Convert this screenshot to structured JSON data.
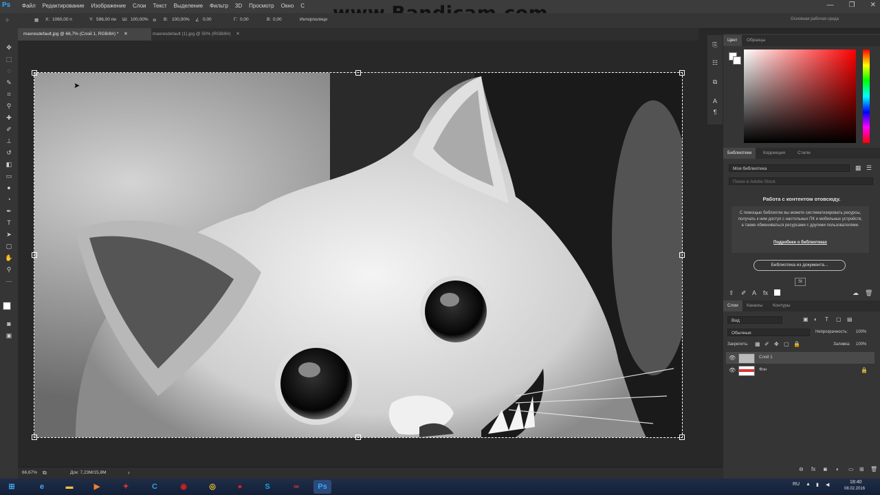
{
  "app": {
    "logo": "Ps",
    "watermark": "www.Bandicam.com"
  },
  "menu": [
    "Файл",
    "Редактирование",
    "Изображение",
    "Слои",
    "Текст",
    "Выделение",
    "Фильтр",
    "3D",
    "Просмотр",
    "Окно",
    "С"
  ],
  "window_controls": {
    "minimize": "—",
    "maximize": "❐",
    "close": "✕"
  },
  "options": {
    "x_label": "X:",
    "x_value": "1060,00 п",
    "y_label": "Y:",
    "y_value": "596,00 пи",
    "w_label": "Ш:",
    "w_value": "100,00%",
    "h_label": "В:",
    "h_value": "100,00%",
    "angle_value": "0,00",
    "hskew_label": "Г:",
    "hskew_value": "0,00",
    "vskew_label": "В:",
    "vskew_value": "0,00",
    "interpolation_label": "Интерполяци",
    "workspace": "Основная рабочая среда"
  },
  "tabs": [
    {
      "label": "maxresdefault.jpg @ 66,7% (Слой 1, RGB/8#) *",
      "close": "✕"
    },
    {
      "label": "maxresdefault (1).jpg @ 50% (RGB/8#)",
      "close": "✕"
    }
  ],
  "status": {
    "zoom": "66,67%",
    "doc": "Док: 7,23M/15,8M",
    "arrow": "›"
  },
  "color_panel": {
    "tabs": [
      "Цвет",
      "Образцы"
    ]
  },
  "libraries_panel": {
    "tabs": [
      "Библиотеки",
      "Коррекция",
      "Стили"
    ],
    "library_name": "Моя библиотека",
    "search_placeholder": "Поиск в Adobe Stock",
    "title": "Работа с контентом отовсюду.",
    "description": "С помощью библиотек вы можете систематизировать ресурсы, получать к ним доступ с настольных ПК и мобильных устройств, а также обмениваться ресурсами с другими пользователями.",
    "link": "Подробнее о библиотеках",
    "button": "Библиотека из документа...",
    "size_badge": "St"
  },
  "layers_panel": {
    "tabs": [
      "Слои",
      "Каналы",
      "Контуры"
    ],
    "filter": "Вид",
    "blend_mode": "Обычные",
    "opacity_label": "Непрозрачность:",
    "opacity_value": "100%",
    "lock_label": "Закрепить:",
    "fill_label": "Заливка:",
    "fill_value": "100%",
    "layers": [
      {
        "name": "Слой 1",
        "visible": true,
        "selected": true
      },
      {
        "name": "Фон",
        "visible": true,
        "locked": true
      }
    ]
  },
  "taskbar": {
    "language": "RU",
    "time": "18:40",
    "date": "08.02.2016",
    "apps": [
      "windows-start",
      "internet-explorer",
      "file-explorer",
      "media-player",
      "ccleaner",
      "bandicam",
      "chrome",
      "opera",
      "skype",
      "creative-cloud",
      "photoshop"
    ]
  },
  "colors": {
    "accent": "#31a8ff",
    "panel": "#353535",
    "canvas": "#282828"
  }
}
